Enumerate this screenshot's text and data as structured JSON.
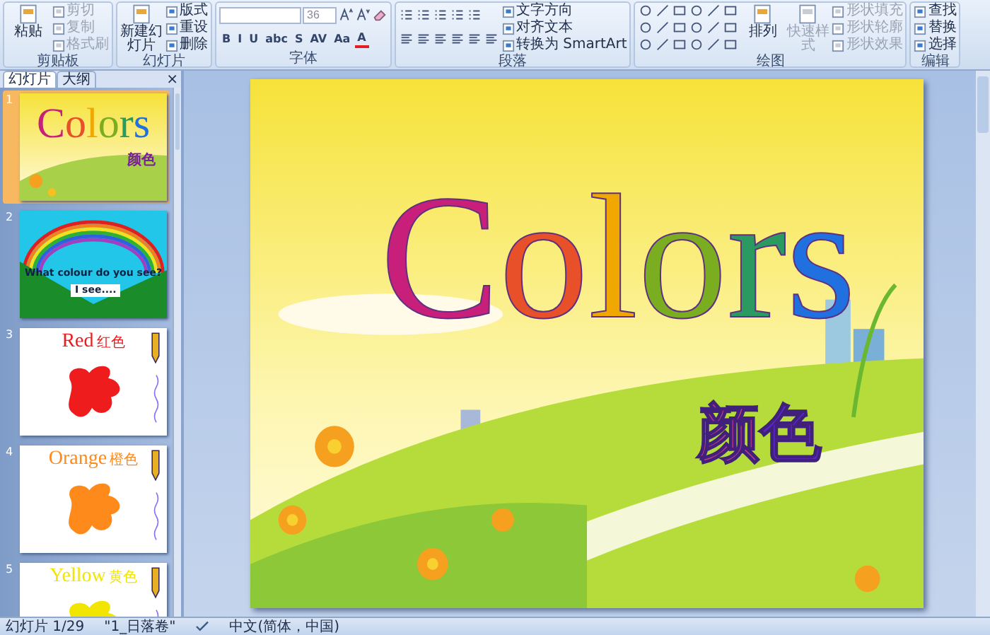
{
  "ribbon": {
    "groups": [
      {
        "label": "剪贴板",
        "columns": [
          [
            {
              "kind": "large",
              "label": "粘贴",
              "disabled": false
            }
          ],
          [
            {
              "kind": "small",
              "label": "剪切",
              "disabled": true
            },
            {
              "kind": "small",
              "label": "复制",
              "disabled": true
            },
            {
              "kind": "small",
              "label": "格式刷",
              "disabled": true
            }
          ]
        ]
      },
      {
        "label": "幻灯片",
        "columns": [
          [
            {
              "kind": "large",
              "label": "新建幻灯片",
              "disabled": false
            }
          ],
          [
            {
              "kind": "small",
              "label": "版式",
              "disabled": false
            },
            {
              "kind": "small",
              "label": "重设",
              "disabled": false
            },
            {
              "kind": "small",
              "label": "删除",
              "disabled": false
            }
          ]
        ]
      },
      {
        "label": "字体",
        "columns": [
          [
            {
              "kind": "font-box",
              "size": "36"
            },
            {
              "kind": "glyph-row",
              "glyphs": [
                "B",
                "I",
                "U",
                "abc",
                "S",
                "AV",
                "Aa",
                "A"
              ]
            }
          ]
        ]
      },
      {
        "label": "段落",
        "columns": [
          [
            {
              "kind": "list-row"
            },
            {
              "kind": "align-row"
            }
          ],
          [
            {
              "kind": "small",
              "label": "文字方向",
              "disabled": false
            },
            {
              "kind": "small",
              "label": "对齐文本",
              "disabled": false
            },
            {
              "kind": "small",
              "label": "转换为 SmartArt",
              "disabled": false
            }
          ]
        ]
      },
      {
        "label": "绘图",
        "columns": [
          [
            {
              "kind": "shape-grid"
            }
          ],
          [
            {
              "kind": "large",
              "label": "排列",
              "disabled": false
            }
          ],
          [
            {
              "kind": "large",
              "label": "快速样式",
              "disabled": true
            }
          ],
          [
            {
              "kind": "small",
              "label": "形状填充",
              "disabled": true
            },
            {
              "kind": "small",
              "label": "形状轮廓",
              "disabled": true
            },
            {
              "kind": "small",
              "label": "形状效果",
              "disabled": true
            }
          ]
        ]
      },
      {
        "label": "编辑",
        "columns": [
          [
            {
              "kind": "small",
              "label": "查找",
              "disabled": false
            },
            {
              "kind": "small",
              "label": "替换",
              "disabled": false
            },
            {
              "kind": "small",
              "label": "选择",
              "disabled": false
            }
          ]
        ]
      }
    ]
  },
  "panel": {
    "tabs": [
      {
        "label": "幻灯片",
        "selected": true
      },
      {
        "label": "大纲",
        "selected": false
      }
    ],
    "close": "×",
    "slides": [
      {
        "number": "1",
        "selected": true,
        "kind": "title",
        "title": "Colors",
        "subtitle": "颜色"
      },
      {
        "number": "2",
        "selected": false,
        "kind": "rainbow",
        "question": "What colour do you see?",
        "answer": "I see...."
      },
      {
        "number": "3",
        "selected": false,
        "kind": "color",
        "title": "Red",
        "subtitle": "红色",
        "color": "#ee1c1c"
      },
      {
        "number": "4",
        "selected": false,
        "kind": "color",
        "title": "Orange",
        "subtitle": "橙色",
        "color": "#ff8a1c"
      },
      {
        "number": "5",
        "selected": false,
        "kind": "color",
        "title": "Yellow",
        "subtitle": "黄色",
        "color": "#f2e600"
      }
    ]
  },
  "slide": {
    "title": "Colors",
    "subtitle": "颜色"
  },
  "status_bar": {
    "slide": "幻灯片 1/29",
    "theme": "\"1_日落卷\"",
    "language": "中文(简体，中国)"
  }
}
